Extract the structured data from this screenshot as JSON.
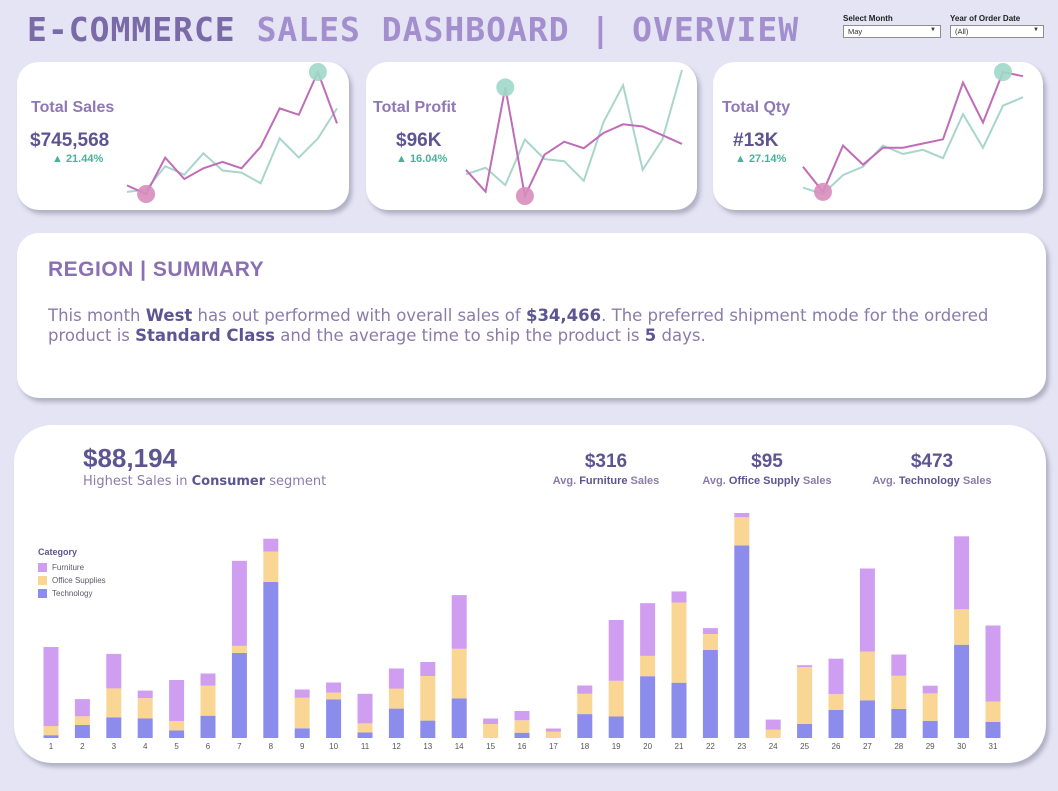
{
  "header": {
    "title_part1": "E-COMMERCE",
    "title_part2": "SALES DASHBOARD | OVERVIEW"
  },
  "filters": {
    "month": {
      "label": "Select Month",
      "value": "May"
    },
    "year": {
      "label": "Year of Order Date",
      "value": "(All)"
    }
  },
  "kpis": [
    {
      "title": "Total Sales",
      "value": "$745,568",
      "delta": "▲ 21.44%"
    },
    {
      "title": "Total Profit",
      "value": "$96K",
      "delta": "▲ 16.04%"
    },
    {
      "title": "Total Qty",
      "value": "#13K",
      "delta": "▲ 27.14%"
    }
  ],
  "region": {
    "title": "REGION | SUMMARY",
    "text_1": "This month ",
    "region_name": "West",
    "text_2": " has out performed with overall sales of ",
    "sales": "$34,466",
    "text_3": ". The preferred shipment mode for the ordered product is ",
    "ship_mode": "Standard Class",
    "text_4": " and the average time to ship the product is ",
    "days": "5",
    "text_5": " days."
  },
  "segment": {
    "value": "$88,194",
    "prefix": "Highest Sales in ",
    "name": "Consumer",
    "suffix": " segment"
  },
  "averages": [
    {
      "value": "$316",
      "prefix": "Avg. ",
      "name": "Furniture",
      "suffix": " Sales"
    },
    {
      "value": "$95",
      "prefix": "Avg. ",
      "name": "Office Supply",
      "suffix": " Sales"
    },
    {
      "value": "$473",
      "prefix": "Avg. ",
      "name": "Technology",
      "suffix": " Sales"
    }
  ],
  "colors": {
    "furniture": "#d09ef0",
    "office": "#fad694",
    "technology": "#8b8ceb",
    "current_line": "#c06cb8",
    "previous_line": "#a8d6ca",
    "min_dot": "#d88dbd",
    "max_dot": "#9fd9c8"
  },
  "sparklines": [
    {
      "current": [
        9,
        5,
        22,
        12,
        17,
        20,
        17,
        27,
        45,
        42,
        62,
        38
      ],
      "previous": [
        6,
        7,
        18,
        14,
        24,
        16,
        15,
        10,
        31,
        22,
        31,
        45
      ]
    },
    {
      "current": [
        14,
        4,
        52,
        2,
        21,
        27,
        24,
        31,
        35,
        34,
        30,
        26
      ],
      "previous": [
        12,
        15,
        7,
        28,
        19,
        18,
        9,
        36,
        53,
        14,
        28,
        60
      ]
    },
    {
      "current": [
        15,
        3,
        25,
        16,
        24,
        24,
        26,
        28,
        55,
        36,
        60,
        58
      ],
      "previous": [
        5,
        2,
        11,
        15,
        25,
        21,
        23,
        19,
        40,
        24,
        44,
        48
      ]
    }
  ],
  "chart_data": {
    "type": "bar",
    "stacked": true,
    "legend_title": "Category",
    "categories": [
      "1",
      "2",
      "3",
      "4",
      "5",
      "6",
      "7",
      "8",
      "9",
      "10",
      "11",
      "12",
      "13",
      "14",
      "15",
      "16",
      "17",
      "18",
      "19",
      "20",
      "21",
      "22",
      "23",
      "24",
      "25",
      "26",
      "27",
      "28",
      "29",
      "30",
      "31"
    ],
    "series": [
      {
        "name": "Technology",
        "values": [
          140,
          640,
          1020,
          970,
          370,
          1100,
          4200,
          7700,
          480,
          1900,
          270,
          1450,
          860,
          1950,
          0,
          260,
          0,
          1180,
          1060,
          3050,
          2730,
          4350,
          9500,
          0,
          700,
          1380,
          1860,
          1430,
          850,
          4600,
          800
        ]
      },
      {
        "name": "Office Supplies",
        "values": [
          450,
          430,
          1430,
          1000,
          470,
          1480,
          340,
          1500,
          1500,
          340,
          450,
          990,
          2200,
          2450,
          690,
          610,
          310,
          1000,
          1760,
          1000,
          3950,
          780,
          1400,
          410,
          2800,
          780,
          2400,
          1640,
          1350,
          1750,
          1000
        ]
      },
      {
        "name": "Furniture",
        "values": [
          3900,
          850,
          1700,
          370,
          2020,
          600,
          4200,
          630,
          410,
          500,
          1460,
          990,
          690,
          2650,
          270,
          460,
          160,
          410,
          3000,
          2600,
          550,
          290,
          200,
          500,
          90,
          1750,
          4100,
          1050,
          380,
          3600,
          3750
        ]
      }
    ],
    "ylim": [
      0,
      11000
    ],
    "grid": false,
    "legend_position": "top-left"
  }
}
